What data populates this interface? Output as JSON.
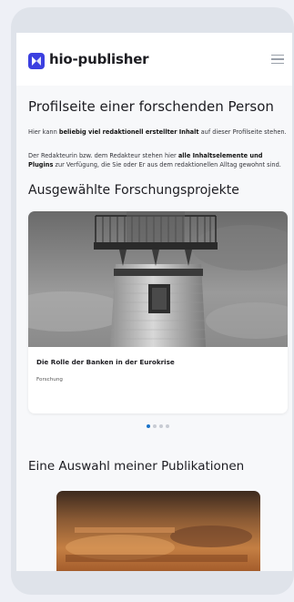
{
  "brand": {
    "name": "hio-publisher"
  },
  "page": {
    "title": "Profilseite einer forschenden Person",
    "intro": {
      "p1_before": "Hier kann ",
      "p1_bold": "beliebig viel redaktionell erstellter Inhalt",
      "p1_after": " auf dieser Profilseite stehen.",
      "p2_before": "Der Redakteurin bzw. dem Redakteur stehen hier ",
      "p2_bold": "alle Inhaltselemente und Plugins",
      "p2_after": " zur Verfügung, die Sie oder Er aus dem redaktionellen Alltag gewohnt sind."
    }
  },
  "projects": {
    "heading": "Ausgewählte Forschungsprojekte",
    "cards": [
      {
        "title": "Die Rolle der Banken in der Eurokrise",
        "tag": "Forschung"
      }
    ],
    "carousel": {
      "count": 4,
      "active": 0
    }
  },
  "publications": {
    "heading": "Eine Auswahl meiner Publikationen"
  },
  "colors": {
    "accent": "#3b3fe0",
    "dot_active": "#1a73c9",
    "dot_inactive": "#c8ccd3"
  },
  "icons": {
    "logo": "logo-icon",
    "menu": "hamburger-menu-icon"
  }
}
